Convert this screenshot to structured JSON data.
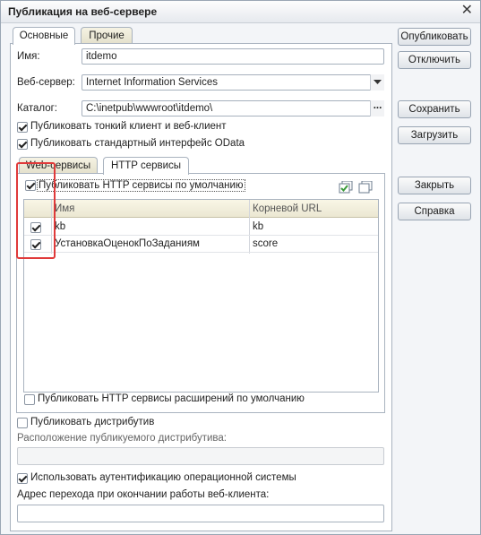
{
  "window": {
    "title": "Публикация на веб-сервере",
    "close_glyph": "✕"
  },
  "tabs": {
    "main": "Основные",
    "other": "Прочие"
  },
  "form": {
    "name_label": "Имя:",
    "name_value": "itdemo",
    "server_label": "Веб-сервер:",
    "server_value": "Internet Information Services",
    "catalog_label": "Каталог:",
    "catalog_value": "C:\\inetpub\\wwwroot\\itdemo\\",
    "catalog_browse": "...",
    "publish_thin_client": "Публиковать тонкий клиент и веб-клиент",
    "publish_odata": "Публиковать стандартный интерфейс OData"
  },
  "inner_tabs": {
    "web_services": "Web-сервисы",
    "http_services": "HTTP сервисы"
  },
  "http": {
    "publish_default": "Публиковать HTTP сервисы по умолчанию",
    "columns": [
      "Имя",
      "Корневой URL"
    ],
    "rows": [
      {
        "name": "kb",
        "url": "kb",
        "checked": true
      },
      {
        "name": "УстановкаОценокПоЗаданиям",
        "url": "score",
        "checked": true
      }
    ],
    "publish_extensions": "Публиковать HTTP сервисы расширений по умолчанию"
  },
  "distrib": {
    "publish_label": "Публиковать дистрибутив",
    "location_label": "Расположение публикуемого дистрибутива:",
    "location_value": ""
  },
  "auth": {
    "use_os_auth": "Использовать аутентификацию операционной системы",
    "exit_url_label": "Адрес перехода при окончании работы веб-клиента:",
    "exit_url_value": ""
  },
  "buttons": {
    "publish": "Опубликовать",
    "disable": "Отключить",
    "save": "Сохранить",
    "load": "Загрузить",
    "close": "Закрыть",
    "help": "Справка"
  },
  "colors": {
    "highlight": "#e03a3a",
    "accent_green": "#3a9a3a"
  }
}
